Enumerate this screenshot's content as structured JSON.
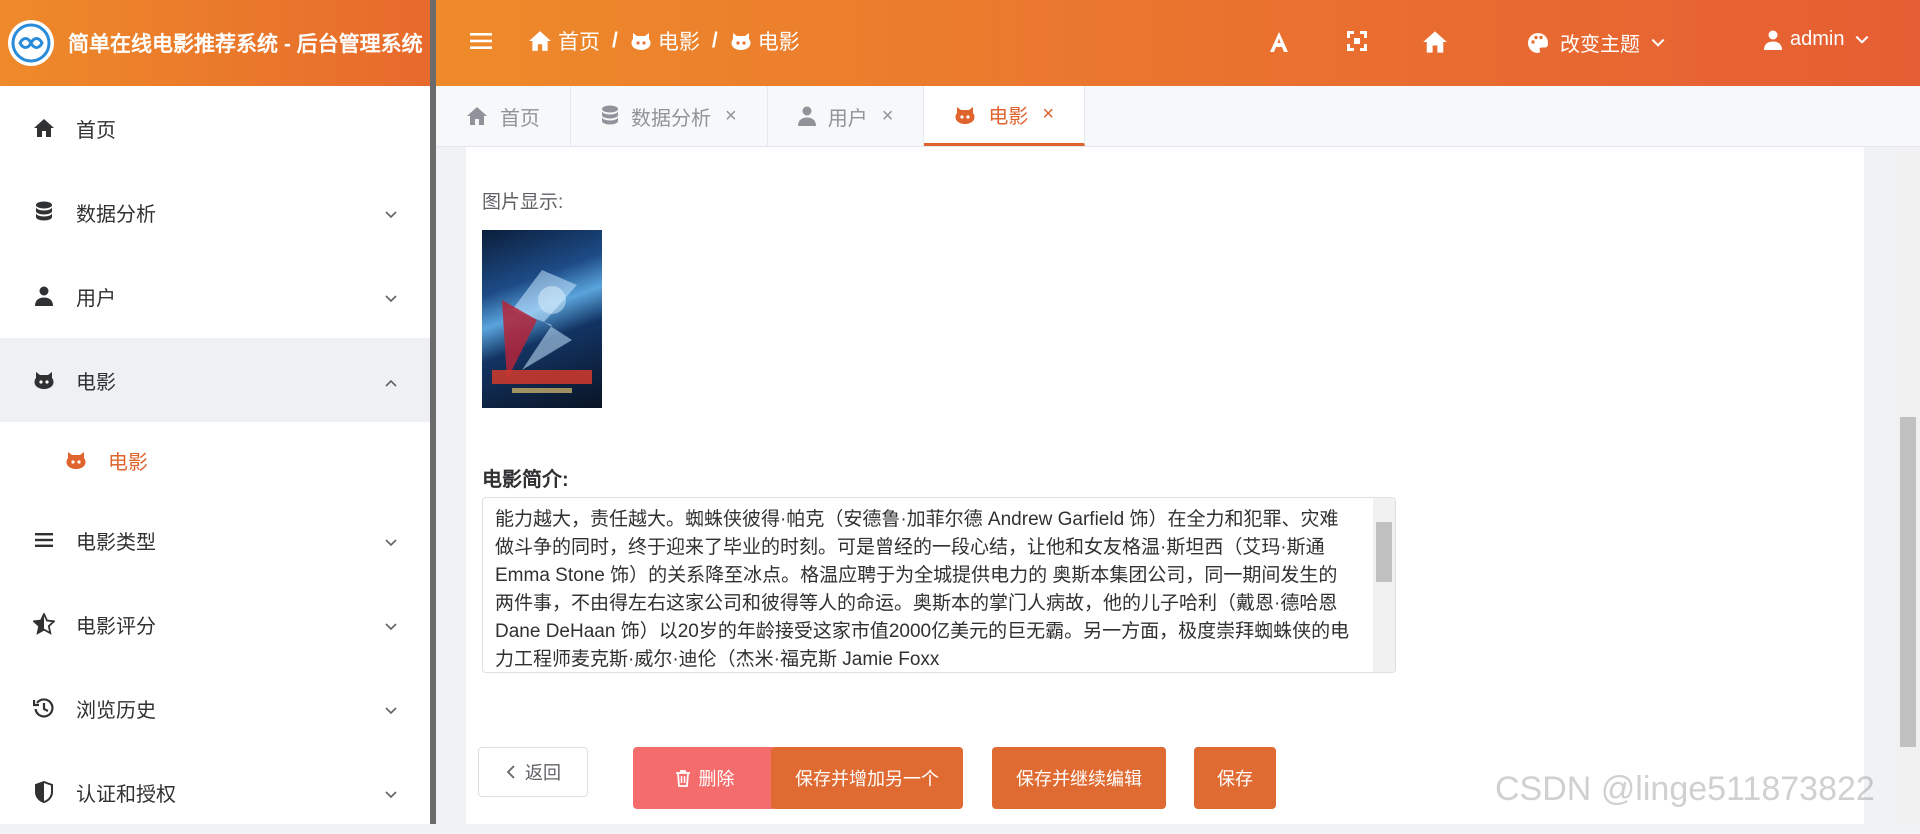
{
  "app": {
    "title": "简单在线电影推荐系统 - 后台管理系统"
  },
  "header": {
    "breadcrumb": [
      "首页",
      "电影",
      "电影"
    ],
    "breadcrumb_sep": "/",
    "theme_label": "改变主题",
    "user": "admin",
    "colors": {
      "gradient_start": "#ee8a2a",
      "gradient_end": "#e65e33"
    }
  },
  "sidebar": {
    "items": [
      {
        "label": "首页",
        "icon": "home-icon"
      },
      {
        "label": "数据分析",
        "icon": "database-icon"
      },
      {
        "label": "用户",
        "icon": "user-icon"
      },
      {
        "label": "电影",
        "icon": "github-cat-icon",
        "expanded": true
      },
      {
        "label": "电影类型",
        "icon": "list-icon"
      },
      {
        "label": "电影评分",
        "icon": "star-half-icon"
      },
      {
        "label": "浏览历史",
        "icon": "history-icon"
      },
      {
        "label": "认证和授权",
        "icon": "shield-icon"
      }
    ],
    "subitems": [
      {
        "label": "电影",
        "icon": "github-cat-icon"
      }
    ]
  },
  "tabs": [
    {
      "label": "首页",
      "icon": "home-icon",
      "closable": false
    },
    {
      "label": "数据分析",
      "icon": "database-icon",
      "closable": true
    },
    {
      "label": "用户",
      "icon": "user-icon",
      "closable": true
    },
    {
      "label": "电影",
      "icon": "github-cat-icon",
      "closable": true,
      "active": true
    }
  ],
  "form": {
    "image_label": "图片显示:",
    "synopsis_label": "电影简介:",
    "synopsis_text": "能力越大，责任越大。蜘蛛侠彼得·帕克（安德鲁·加菲尔德 Andrew Garfield 饰）在全力和犯罪、灾难做斗争的同时，终于迎来了毕业的时刻。可是曾经的一段心结，让他和女友格温·斯坦西（艾玛·斯通 Emma Stone 饰）的关系降至冰点。格温应聘于为全城提供电力的 奥斯本集团公司，同一期间发生的两件事，不由得左右这家公司和彼得等人的命运。奥斯本的掌门人病故，他的儿子哈利（戴恩·德哈恩 Dane DeHaan 饰）以20岁的年龄接受这家市值2000亿美元的巨无霸。另一方面，极度崇拜蜘蛛侠的电力工程师麦克斯·威尔·迪伦（杰米·福克斯 Jamie Foxx"
  },
  "buttons": {
    "back": "返回",
    "delete": "删除",
    "save_add": "保存并增加另一个",
    "save_continue": "保存并继续编辑",
    "save": "保存"
  },
  "watermark": "CSDN @linge511873822"
}
